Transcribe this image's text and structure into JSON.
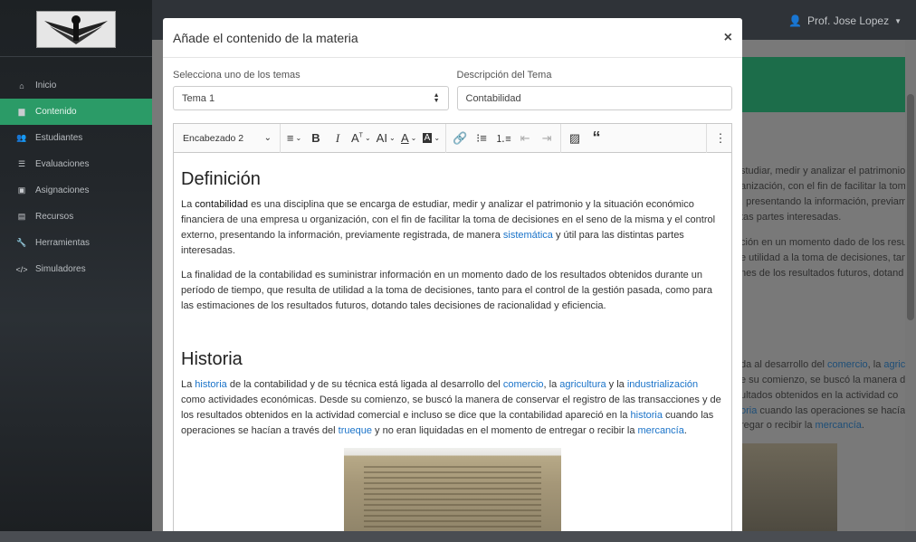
{
  "sidebar": {
    "items": [
      {
        "label": "Inicio",
        "icon": "home-icon",
        "glyph": "⌂"
      },
      {
        "label": "Contenido",
        "icon": "book-icon",
        "glyph": "▆",
        "active": true
      },
      {
        "label": "Estudiantes",
        "icon": "users-icon",
        "glyph": "👥"
      },
      {
        "label": "Evaluaciones",
        "icon": "list-icon",
        "glyph": "☰"
      },
      {
        "label": "Asignaciones",
        "icon": "clipboard-icon",
        "glyph": "▣"
      },
      {
        "label": "Recursos",
        "icon": "archive-icon",
        "glyph": "▤"
      },
      {
        "label": "Herramientas",
        "icon": "wrench-icon",
        "glyph": "🔧"
      },
      {
        "label": "Simuladores",
        "icon": "code-icon",
        "glyph": "</>"
      }
    ]
  },
  "topbar": {
    "user_name": "Prof. Jose Lopez"
  },
  "modal": {
    "title": "Añade el contenido de la materia",
    "close_label": "×",
    "topic_select": {
      "label": "Selecciona uno de los temas",
      "value": "Tema 1"
    },
    "description": {
      "label": "Descripción del Tema",
      "value": "Contabilidad"
    },
    "toolbar": {
      "heading_value": "Encabezado 2"
    },
    "content": {
      "h1": "Definición",
      "p1_a": "La ",
      "p1_b": "contabilidad",
      "p1_c": " es una disciplina que se encarga de estudiar, medir y analizar el patrimonio y la situación económico financiera de una empresa u organización, con el fin de facilitar la toma de decisiones en el seno de la misma y el control externo, presentando la información, previamente registrada, de manera ",
      "p1_link": "sistemática",
      "p1_d": " y útil para las distintas partes interesadas.",
      "p2": "La finalidad de la contabilidad es suministrar información en un momento dado de los resultados obtenidos durante un período de tiempo, que resulta de utilidad a la toma de decisiones, tanto para el control de la gestión pasada, como para las estimaciones de los resultados futuros, dotando tales decisiones de racionalidad y eficiencia.",
      "h2": "Historia",
      "p3_a": "La ",
      "p3_l1": "historia",
      "p3_b": " de la contabilidad y de su técnica está ligada al desarrollo del ",
      "p3_l2": "comercio",
      "p3_c": ", la ",
      "p3_l3": "agricultura",
      "p3_d": " y la ",
      "p3_l4": "industrialización",
      "p3_e": " como actividades económicas. Desde su comienzo, se buscó la manera de conservar el registro de las transacciones y de los resultados obtenidos en la actividad comercial e incluso se dice que la contabilidad apareció en la ",
      "p3_l5": "historia",
      "p3_f": " cuando las operaciones se hacían a través del ",
      "p3_l6": "trueque",
      "p3_g": " y no eran liquidadas en el momento de entregar o recibir la ",
      "p3_l7": "mercancía",
      "p3_h": "."
    }
  },
  "background_text": {
    "line1": "studiar, medir y analizar el patrimonio",
    "line2": "anización, con el fin de facilitar la tom",
    "line3": ", presentando la información, previam",
    "line4": "tas partes interesadas.",
    "line5": "ción en un momento dado de los resu",
    "line6": "e utilidad a la toma de decisiones, tan",
    "line7": "nes de los resultados futuros, dotand",
    "line8_a": "da al desarrollo del ",
    "line8_l1": "comercio",
    "line8_b": ", la ",
    "line8_l2": "agric",
    "line9": "e su comienzo, se buscó la manera d",
    "line10": "ultados obtenidos en la actividad co",
    "line11_l": "oria",
    "line11_b": " cuando las operaciones se hacía",
    "line12_a": "regar o recibir la ",
    "line12_l": "mercancía",
    "line12_b": "."
  },
  "colors": {
    "accent_green": "#2b9b67",
    "link_blue": "#1a73c9"
  }
}
